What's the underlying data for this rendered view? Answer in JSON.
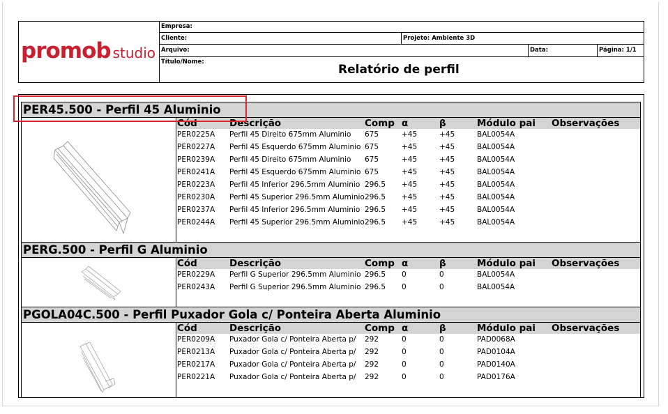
{
  "header": {
    "logo_main": "promob",
    "logo_studio": "studio",
    "empresa_label": "Empresa:",
    "cliente_label": "Cliente:",
    "projeto_label": "Projeto: Ambiente 3D",
    "arquivo_label": "Arquivo:",
    "data_label": "Data:",
    "pagina_label": "Página: 1/1",
    "titulo_label": "Título/Nome:",
    "report_title": "Relatório de perfil"
  },
  "columns": {
    "cod": "Cód",
    "desc": "Descrição",
    "comp": "Comp",
    "alpha": "α",
    "beta": "β",
    "modulo": "Módulo pai",
    "obs": "Observações"
  },
  "sections": [
    {
      "title": "PER45.500 - Perfil 45 Aluminio",
      "rows": [
        {
          "cod": "PER0225A",
          "desc": "Perfil 45 Direito 675mm Aluminio",
          "comp": "675",
          "alpha": "+45",
          "beta": "+45",
          "modulo": "BAL0054A",
          "obs": ""
        },
        {
          "cod": "PER0227A",
          "desc": "Perfil 45 Esquerdo 675mm Aluminio",
          "comp": "675",
          "alpha": "+45",
          "beta": "+45",
          "modulo": "BAL0054A",
          "obs": ""
        },
        {
          "cod": "PER0239A",
          "desc": "Perfil 45 Direito 675mm Aluminio",
          "comp": "675",
          "alpha": "+45",
          "beta": "+45",
          "modulo": "BAL0054A",
          "obs": ""
        },
        {
          "cod": "PER0241A",
          "desc": "Perfil 45 Esquerdo 675mm Aluminio",
          "comp": "675",
          "alpha": "+45",
          "beta": "+45",
          "modulo": "BAL0054A",
          "obs": ""
        },
        {
          "cod": "PER0223A",
          "desc": "Perfil 45 Inferior 296.5mm Aluminio",
          "comp": "296.5",
          "alpha": "+45",
          "beta": "+45",
          "modulo": "BAL0054A",
          "obs": ""
        },
        {
          "cod": "PER0230A",
          "desc": "Perfil 45 Superior 296.5mm Aluminio",
          "comp": "296.5",
          "alpha": "+45",
          "beta": "+45",
          "modulo": "BAL0054A",
          "obs": ""
        },
        {
          "cod": "PER0237A",
          "desc": "Perfil 45 Inferior 296.5mm Aluminio",
          "comp": "296.5",
          "alpha": "+45",
          "beta": "+45",
          "modulo": "BAL0054A",
          "obs": ""
        },
        {
          "cod": "PER0244A",
          "desc": "Perfil 45 Superior 296.5mm Aluminio",
          "comp": "296.5",
          "alpha": "+45",
          "beta": "+45",
          "modulo": "BAL0054A",
          "obs": ""
        }
      ]
    },
    {
      "title": "PERG.500 - Perfil G Aluminio",
      "rows": [
        {
          "cod": "PER0229A",
          "desc": "Perfil G Superior 296.5mm Aluminio",
          "comp": "296.5",
          "alpha": "0",
          "beta": "0",
          "modulo": "BAL0054A",
          "obs": ""
        },
        {
          "cod": "PER0243A",
          "desc": "Perfil G Superior 296.5mm Aluminio",
          "comp": "296.5",
          "alpha": "0",
          "beta": "0",
          "modulo": "BAL0054A",
          "obs": ""
        }
      ]
    },
    {
      "title": "PGOLA04C.500 - Perfil Puxador Gola c/ Ponteira Aberta Aluminio",
      "rows": [
        {
          "cod": "PER0209A",
          "desc": "Puxador Gola c/ Ponteira Aberta p/",
          "comp": "292",
          "alpha": "0",
          "beta": "0",
          "modulo": "PAD0068A",
          "obs": ""
        },
        {
          "cod": "PER0213A",
          "desc": "Puxador Gola c/ Ponteira Aberta p/",
          "comp": "292",
          "alpha": "0",
          "beta": "0",
          "modulo": "PAD0104A",
          "obs": ""
        },
        {
          "cod": "PER0217A",
          "desc": "Puxador Gola c/ Ponteira Aberta p/",
          "comp": "292",
          "alpha": "0",
          "beta": "0",
          "modulo": "PAD0140A",
          "obs": ""
        },
        {
          "cod": "PER0221A",
          "desc": "Puxador Gola c/ Ponteira Aberta p/",
          "comp": "292",
          "alpha": "0",
          "beta": "0",
          "modulo": "PAD0176A",
          "obs": ""
        }
      ]
    }
  ],
  "highlight_color": "#d9232e",
  "brand_color": "#c8202f"
}
